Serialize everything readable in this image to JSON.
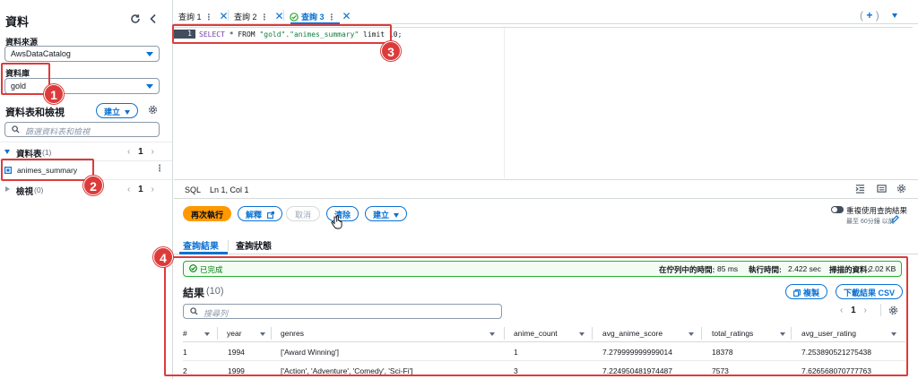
{
  "sidebar": {
    "title": "資料",
    "datasource_label": "資料來源",
    "datasource_value": "AwsDataCatalog",
    "database_label": "資料庫",
    "database_value": "gold",
    "tables_views_title": "資料表和檢視",
    "create_button": "建立",
    "filter_placeholder": "篩選資料表和檢視",
    "tables_group": {
      "label": "資料表",
      "count": "(1)",
      "page": "1"
    },
    "table_item": "animes_summary",
    "views_group": {
      "label": "檢視",
      "count": "(0)",
      "page": "1"
    }
  },
  "query_tabs": [
    {
      "label": "查詢 1"
    },
    {
      "label": "查詢 2"
    },
    {
      "label": "查詢 3",
      "status": "success"
    }
  ],
  "editor": {
    "line_number": "1",
    "code_keyword_select": "SELECT",
    "code_mid": " * FROM ",
    "code_string": "\"gold\".\"animes_summary\"",
    "code_tail": " limit 10;",
    "language": "SQL",
    "cursor": "Ln 1, Col 1"
  },
  "actions": {
    "run_again": "再次執行",
    "explain": "解釋",
    "cancel": "取消",
    "clear": "清除",
    "create": "建立",
    "reuse_label": "重複使用查詢結果",
    "reuse_sub": "最至 60分鐘 以前"
  },
  "result_tabs": [
    "查詢結果",
    "查詢狀態"
  ],
  "results": {
    "status": "已完成",
    "queue_time_label": "在佇列中的時間:",
    "queue_time": "85 ms",
    "run_time_label": "執行時間:",
    "run_time": "2.422 sec",
    "scanned_label": "掃描的資料:",
    "scanned": "2.02 KB",
    "title": "結果",
    "count": "(10)",
    "copy_button": "複製",
    "download_button": "下載結果 CSV",
    "search_placeholder": "搜尋列",
    "page": "1",
    "columns": [
      "#",
      "year",
      "genres",
      "anime_count",
      "avg_anime_score",
      "total_ratings",
      "avg_user_rating"
    ],
    "rows": [
      [
        "1",
        "1994",
        "['Award Winning']",
        "1",
        "7.279999999999014",
        "18378",
        "7.253890521275438"
      ],
      [
        "2",
        "1999",
        "['Action', 'Adventure', 'Comedy', 'Sci-Fi']",
        "3",
        "7.224950481974487",
        "7573",
        "7.626568070777763"
      ]
    ]
  },
  "annotations": [
    "1",
    "2",
    "3",
    "4"
  ],
  "colors": {
    "accent": "#0972d3",
    "primary": "#ff9900",
    "annotation": "#dd3b3b",
    "success": "#29ad32"
  }
}
